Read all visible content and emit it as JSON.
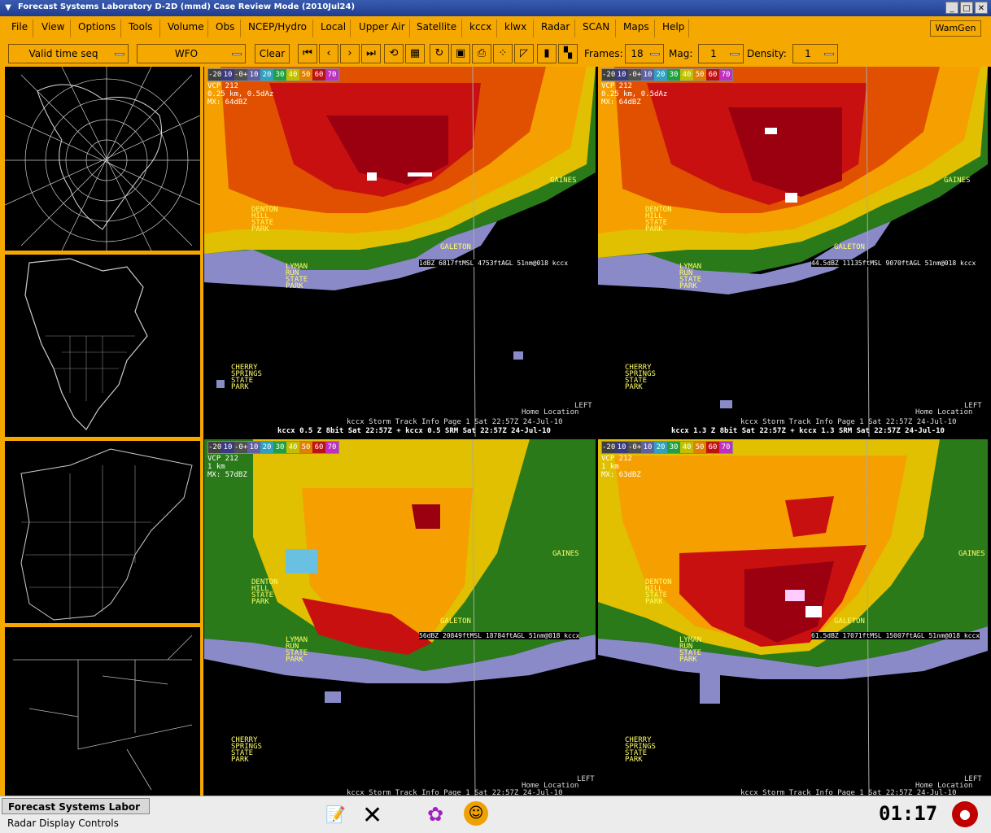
{
  "window": {
    "title": "Forecast Systems Laboratory D-2D (mmd) Case Review Mode (2010Jul24)"
  },
  "menu": {
    "items": [
      "File",
      "View",
      "Options",
      "Tools",
      "Volume",
      "Obs",
      "NCEP/Hydro",
      "Local",
      "Upper Air",
      "Satellite",
      "kccx",
      "klwx",
      "Radar",
      "SCAN",
      "Maps",
      "Help"
    ],
    "wamgen": "WamGen"
  },
  "toolbar": {
    "time_mode": "Valid time seq",
    "scale": "WFO",
    "clear": "Clear",
    "frames_label": "Frames:",
    "frames_value": "18",
    "mag_label": "Mag:",
    "mag_value": "1",
    "density_label": "Density:",
    "density_value": "1"
  },
  "colorbar": [
    "-20",
    "10",
    "-0+",
    "10",
    "20",
    "30",
    "40",
    "50",
    "60",
    "70"
  ],
  "colors": {
    "accent": "#f5a800",
    "title_bar": "#2a4aa0",
    "place_label": "#ffff66"
  },
  "panels": [
    {
      "vcp": "VCP 212",
      "res": "0.25 km, 0.5dAz",
      "mx": "MX: 64dBZ",
      "readout": "1dBZ 6817ftMSL 4753ftAGL 51nm@018 kccx",
      "product": "kccx 0.5 Z  8bit Sat 22:57Z + kccx 0.5 SRM  Sat 22:57Z 24-Jul-10",
      "status": "kccx Storm Track Info Page 1  Sat 22:57Z 24-Jul-10",
      "home": "Home Location",
      "left": "LEFT"
    },
    {
      "vcp": "VCP 212",
      "res": "0.25 km, 0.5dAz",
      "mx": "MX: 64dBZ",
      "readout": "44.5dBZ 11135ftMSL 9070ftAGL 51nm@018 kccx",
      "product": "kccx 1.3 Z  8bit Sat 22:57Z + kccx 1.3 SRM  Sat 22:57Z 24-Jul-10",
      "status": "kccx Storm Track Info Page 1  Sat 22:57Z 24-Jul-10",
      "home": "Home Location",
      "left": "LEFT"
    },
    {
      "vcp": "VCP 212",
      "res": "1 km",
      "mx": "MX: 57dBZ",
      "readout": "56dBZ 20849ftMSL 18784ftAGL 51nm@018 kccx",
      "product": "",
      "status": "kccx Storm Track Info Page 1  Sat 22:57Z 24-Jul-10",
      "home": "Home Location",
      "left": "LEFT"
    },
    {
      "vcp": "VCP 212",
      "res": "1 km",
      "mx": "MX: 63dBZ",
      "readout": "61.5dBZ 17071ftMSL 15007ftAGL 51nm@018 kccx",
      "product": "",
      "status": "kccx Storm Track Info Page 1  Sat 22:57Z 24-Jul-10",
      "home": "Home Location",
      "left": "LEFT"
    }
  ],
  "places": {
    "gaines": "GAINES",
    "galeton": "GALETON",
    "denton": [
      "DENTON",
      "HILL",
      "STATE",
      "PARK"
    ],
    "lyman": [
      "LYMAN",
      "RUN",
      "STATE",
      "PARK"
    ],
    "cherry": [
      "CHERRY",
      "SPRINGS",
      "STATE",
      "PARK"
    ]
  },
  "taskbar": {
    "task1": "Forecast Systems Labor",
    "task2": "Radar Display Controls",
    "clock": "01:17"
  }
}
